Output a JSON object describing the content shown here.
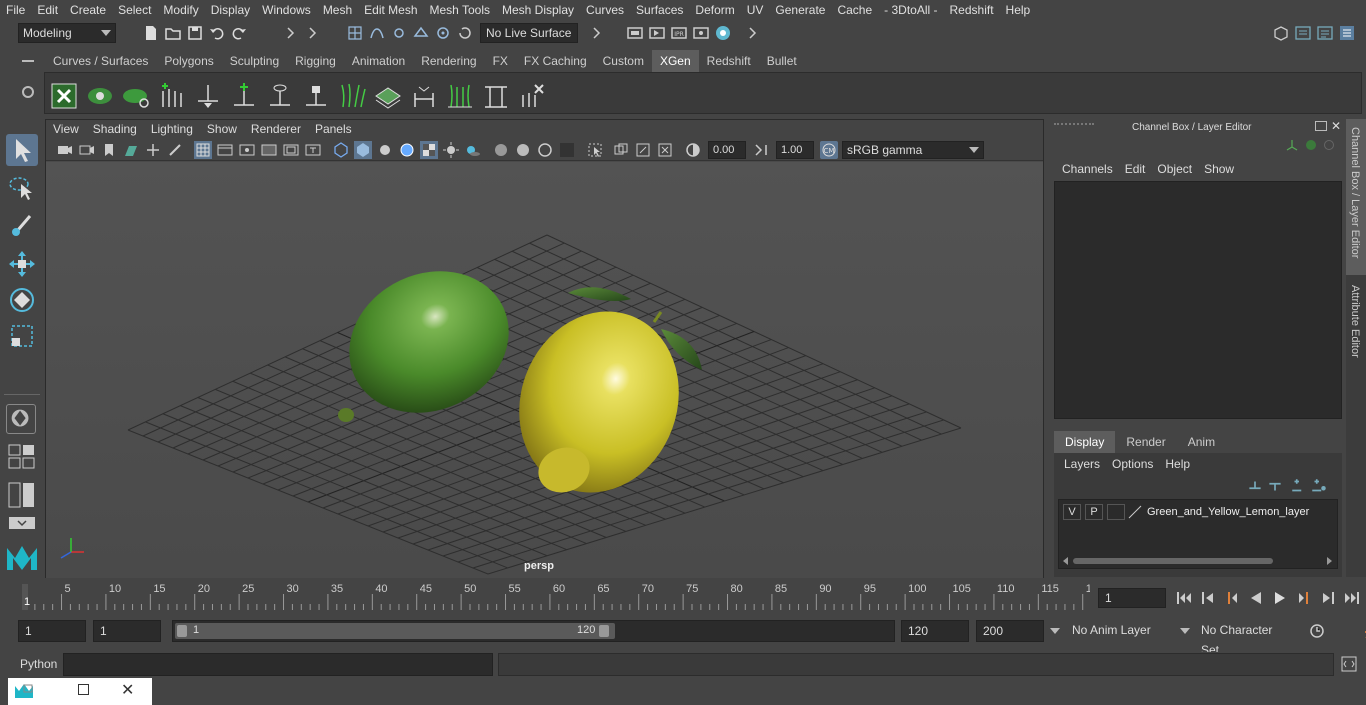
{
  "menubar": {
    "items": [
      "File",
      "Edit",
      "Create",
      "Select",
      "Modify",
      "Display",
      "Windows",
      "Mesh",
      "Edit Mesh",
      "Mesh Tools",
      "Mesh Display",
      "Curves",
      "Surfaces",
      "Deform",
      "UV",
      "Generate",
      "Cache",
      "- 3DtoAll -",
      "Redshift",
      "Help"
    ]
  },
  "statusline": {
    "mode": "Modeling",
    "live_surface": "No Live Surface"
  },
  "shelf": {
    "tabs": [
      "Curves / Surfaces",
      "Polygons",
      "Sculpting",
      "Rigging",
      "Animation",
      "Rendering",
      "FX",
      "FX Caching",
      "Custom",
      "XGen",
      "Redshift",
      "Bullet"
    ],
    "active_tab": "XGen"
  },
  "viewport": {
    "menus": [
      "View",
      "Shading",
      "Lighting",
      "Show",
      "Renderer",
      "Panels"
    ],
    "exposure": "0.00",
    "gamma": "1.00",
    "color_space": "sRGB gamma",
    "camera_label": "persp"
  },
  "channel_box": {
    "title": "Channel Box / Layer Editor",
    "menus": [
      "Channels",
      "Edit",
      "Object",
      "Show"
    ],
    "layer_tabs": [
      "Display",
      "Render",
      "Anim"
    ],
    "active_layer_tab": "Display",
    "layer_menus": [
      "Layers",
      "Options",
      "Help"
    ],
    "layer": {
      "v": "V",
      "p": "P",
      "name": "Green_and_Yellow_Lemon_layer"
    }
  },
  "side_tabs": [
    "Channel Box / Layer Editor",
    "Attribute Editor"
  ],
  "timeline": {
    "ticks": [
      "1",
      "5",
      "10",
      "15",
      "20",
      "25",
      "30",
      "35",
      "40",
      "45",
      "50",
      "55",
      "60",
      "65",
      "70",
      "75",
      "80",
      "85",
      "90",
      "95",
      "100",
      "105",
      "110",
      "115",
      "12"
    ],
    "current_frame": "1"
  },
  "range": {
    "start": "1",
    "playback_start": "1",
    "slider_start": "1",
    "slider_end": "120",
    "playback_end": "120",
    "end": "200",
    "anim_layer": "No Anim Layer",
    "character_set": "No Character Set"
  },
  "cmdline": {
    "label": "Python"
  }
}
